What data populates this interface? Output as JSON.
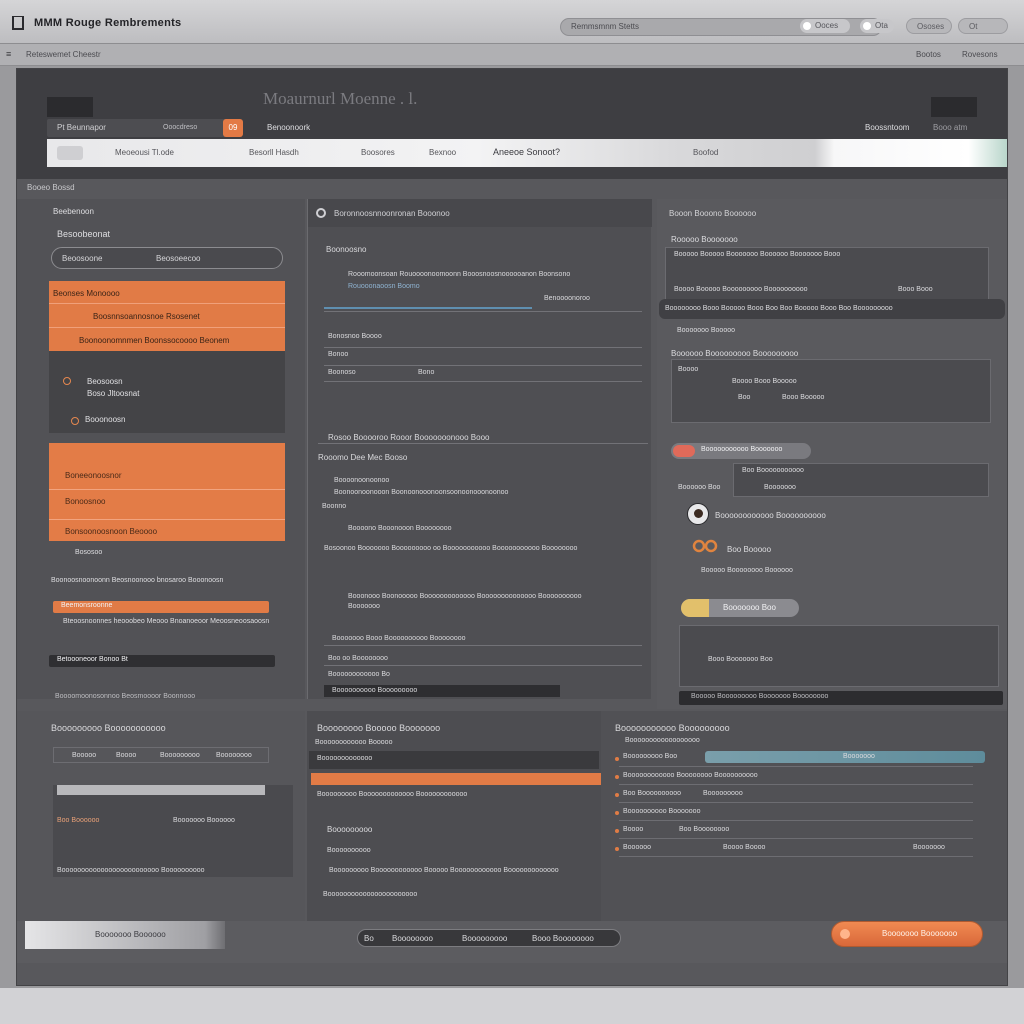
{
  "topbar": {
    "app_title": "MMM Rouge Rembrements",
    "search_placeholder": "Remmsmnm Stetts",
    "toggle1": "Ooces",
    "toggle2": "Ota",
    "btn1": "Ososes",
    "btn2": "Ot"
  },
  "subbar": {
    "menu": "≡",
    "crumb": "Reteswemet Cheestr",
    "right1": "Bootos",
    "right2": "Rovesons"
  },
  "header": {
    "title": "Moaurnurl Moenne . l.",
    "left_field": "Pt Beunnapor",
    "left_field_value": "Ooocdreso",
    "badge": "09",
    "link": "Benoonoork",
    "right": "Boossntoom",
    "right2": "Booo atm"
  },
  "tabs": [
    "Meoeousi Tl.ode",
    "Besorll Hasdh",
    "Boosores",
    "Bexnoo",
    "Aneeoe Sonoot?",
    "Boofod"
  ],
  "section_label": "Booeo Bossd",
  "left": {
    "heading": "Beebenoon",
    "subheading": "Besoobeonat",
    "search_label": "Beoosoone",
    "search_value": "Beosoeecoo",
    "orange_items": [
      "Beonses Monoooo",
      "Boosnnsoannosnoe Rsosenet",
      "Boonoonomnmen Boonssocoooo Beonem"
    ],
    "sub_items": [
      "Beosoosn",
      "Boso Jltoosnat",
      "Booonoosn"
    ],
    "card_items": [
      "Boneeonoosnor",
      "Bonoosnoo",
      "Bonsoonoosnoon Beoooo"
    ],
    "misc1": "Bososoo",
    "misc2": "Boonoosnoonoonn Beosnoonooo bnosaroo Booonoosn",
    "bar1": "Beemonsroonne",
    "text1": "Bteoosnoonnes heooobeo Meooo Bnoanoeoor Meoosneoosaoosn",
    "bar2": "Betoooneoor Bonoo Bt",
    "foot": "Boooomoonosonnoo Beosmoooor Boonnooo"
  },
  "mid": {
    "heading": "Boronnoosnnoonronan Booonoo",
    "sub": "Boonoosno",
    "line1": "Rooomoonsoan Rouoooonoomoonn Booosnoosnoooooanon Boonsono",
    "line2": "Rouooonaoosn Boomo",
    "line3": "Benoooonoroo",
    "field1": "Bonosnoo Boooo",
    "field2": "Bonoo",
    "field3": "Boonoso",
    "field4": "Bono",
    "section2": "Rosoo Booooroo Rooor Booooooonooo Booo",
    "sub2": "Rooomo Dee Mec Booso",
    "text2": "Boooonoonoonoo",
    "text3": "Boonoonoonooon Boonoonooonoonsoonoonooonoonoo",
    "text4": "Boonno",
    "text5": "Boooono Booonooon Boooooooo",
    "text6": "Bosoonoo Booooooo Booooooooo oo Booooooooooo Booooooooooo Boooooooo",
    "text7": "Booonooo Boonooooo Booooooooooooo Boooooooooooooo Boooooooooo",
    "text8": "Booooooo",
    "text9": "Booooooo Booo Boooooooooo Boooooooo",
    "text10": "Boo oo Boooooooo",
    "text11": "Boooooooooooo Bo",
    "text12": "Boooooooooo Booooooooo"
  },
  "right": {
    "heading": "Booon Booono Boooooo",
    "sub": "Rooooo Booooooo",
    "row1": "Booooo Booooo Booooooo Boooooo Booooooo Booo",
    "row2": "Boooo Booooo Booooooooo Boooooooooo",
    "row2b": "Booo Booo",
    "dark_row": "Boooooooo Booo Booooo Booo Boo Boo Booooo Booo Boo Booooooooo",
    "small": "Booooooo Booooo",
    "section": "Boooooo Booooooooo Booooooooo",
    "r1": "Boooo",
    "r2": "Boooo Booo Booooo",
    "r3": "Boo",
    "r4": "Booo Booooo",
    "pill": "Booooooooooo Booooooo",
    "row3a": "Boo Booooooooooo",
    "row3b": "Boooooo Boo",
    "row3c": "Booooooo",
    "avatar_text": "Boooooooooooo Boooooooooo",
    "pretzel_text": "Boo Booooo",
    "pretzel_sub": "Booooo Boooooooo Boooooo",
    "yellow": "Booooooo Boo",
    "text_a": "Booo Booooooo Boo",
    "footbar": "Booooo  Booooooooo Booooooo Boooooooo"
  },
  "bottom": {
    "left_title": "Booooooooo Booooooooooo",
    "left_fields": [
      "Booooo",
      "Boooo",
      "Booooooooo",
      "Boooooooo"
    ],
    "left_rows": [
      "Boo Boooooo",
      "Booooooo Boooooo"
    ],
    "left_foot": "Booooooooooooooooooooooooo Boooooooooo",
    "mid_title": "Boooooooo Booooo Booooooo",
    "mid_sub": "Boooooooooooo Booooo",
    "mid_row1": "Booooooooooooo",
    "mid_row2": "Booooooooo Booooooooooooo Boooooooooooo",
    "mid_head": "Booooooooo",
    "mid_text1": "Boooooooooo",
    "mid_text2": "Booooooooo Boooooooooooo Booooo Boooooooooooo Booooooooooooo",
    "mid_text3": "Booooooooooooooooooooooo",
    "right_title": "Booooooooooo Booooooooo",
    "right_sub": "Boooooooooooooooooo",
    "right_rows": [
      [
        "Booooooooo Boo",
        "Booooooooooooooooooo",
        "Booooooo"
      ],
      [
        "Boooooooooooo Boooooooo Boooooooooo",
        "",
        ""
      ],
      [
        "Boo Boooooooooo",
        "Booooooooo",
        ""
      ],
      [
        "Boooooooooo Booooooo",
        "",
        ""
      ],
      [
        "Boooo",
        "Boo Boooooooo",
        ""
      ],
      [
        "Boooooo",
        "Boooo Boooo",
        "Booooooo"
      ]
    ]
  },
  "status": {
    "left": "Booooooo Boooooo",
    "pill_items": [
      "Bo",
      "Boooooooo",
      "Booooooooo",
      "Booo Boooooooo"
    ],
    "button": "Booooooo Booooooo"
  },
  "colors": {
    "accent": "#e17b46",
    "teal": "#5e8c9b",
    "yellow": "#e2c06b",
    "red": "#e06a5a"
  }
}
